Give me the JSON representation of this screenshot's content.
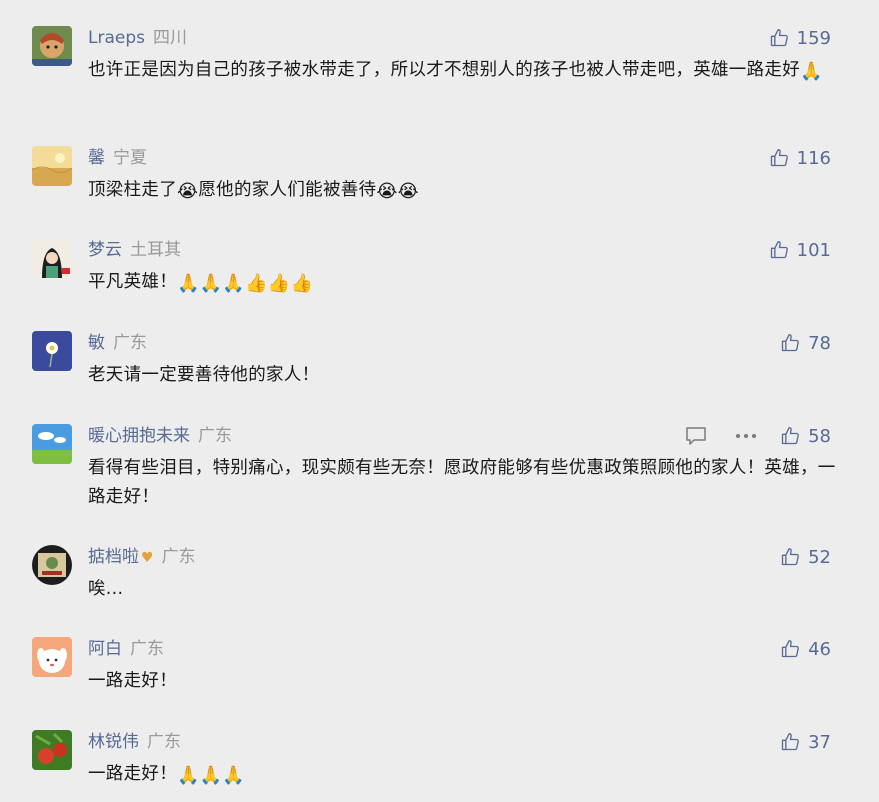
{
  "comments": [
    {
      "name": "Lraeps",
      "region": "四川",
      "likes": "159",
      "text": "也许正是因为自己的孩子被水带走了，所以才不想别人的孩子也被人带走吧，英雄一路走好",
      "emoji": "🙏",
      "avatar_color": "#7a9a5a"
    },
    {
      "name": "馨",
      "region": "宁夏",
      "likes": "116",
      "text_parts": [
        "顶梁柱走了",
        "愿他的家人们能被善待"
      ],
      "emoji_a": "😭",
      "emoji_b": "😭😭",
      "avatar_color": "#e8c878"
    },
    {
      "name": "梦云",
      "region": "土耳其",
      "likes": "101",
      "text": "平凡英雄！",
      "emoji": "🙏🙏🙏👍👍👍",
      "avatar_color": "#e8e2d8"
    },
    {
      "name": "敏",
      "region": "广东",
      "likes": "78",
      "text": "老天请一定要善待他的家人！",
      "avatar_color": "#3b4a9c"
    },
    {
      "name": "暖心拥抱未来",
      "region": "广东",
      "likes": "58",
      "text": "看得有些泪目，特别痛心，现实颇有些无奈！愿政府能够有些优惠政策照顾他的家人！英雄，一路走好！",
      "avatar_color": "#3e8fd8"
    },
    {
      "name": "掂档啦",
      "region": "广东",
      "badge": "♥",
      "likes": "52",
      "text": "唉...",
      "avatar_color": "#2a2a2a"
    },
    {
      "name": "阿白",
      "region": "广东",
      "likes": "46",
      "text": "一路走好！",
      "avatar_color": "#f3a77a"
    },
    {
      "name": "林锐伟",
      "region": "广东",
      "likes": "37",
      "text": "一路走好！",
      "emoji": "🙏🙏🙏",
      "avatar_color": "#4f8a2f"
    }
  ]
}
